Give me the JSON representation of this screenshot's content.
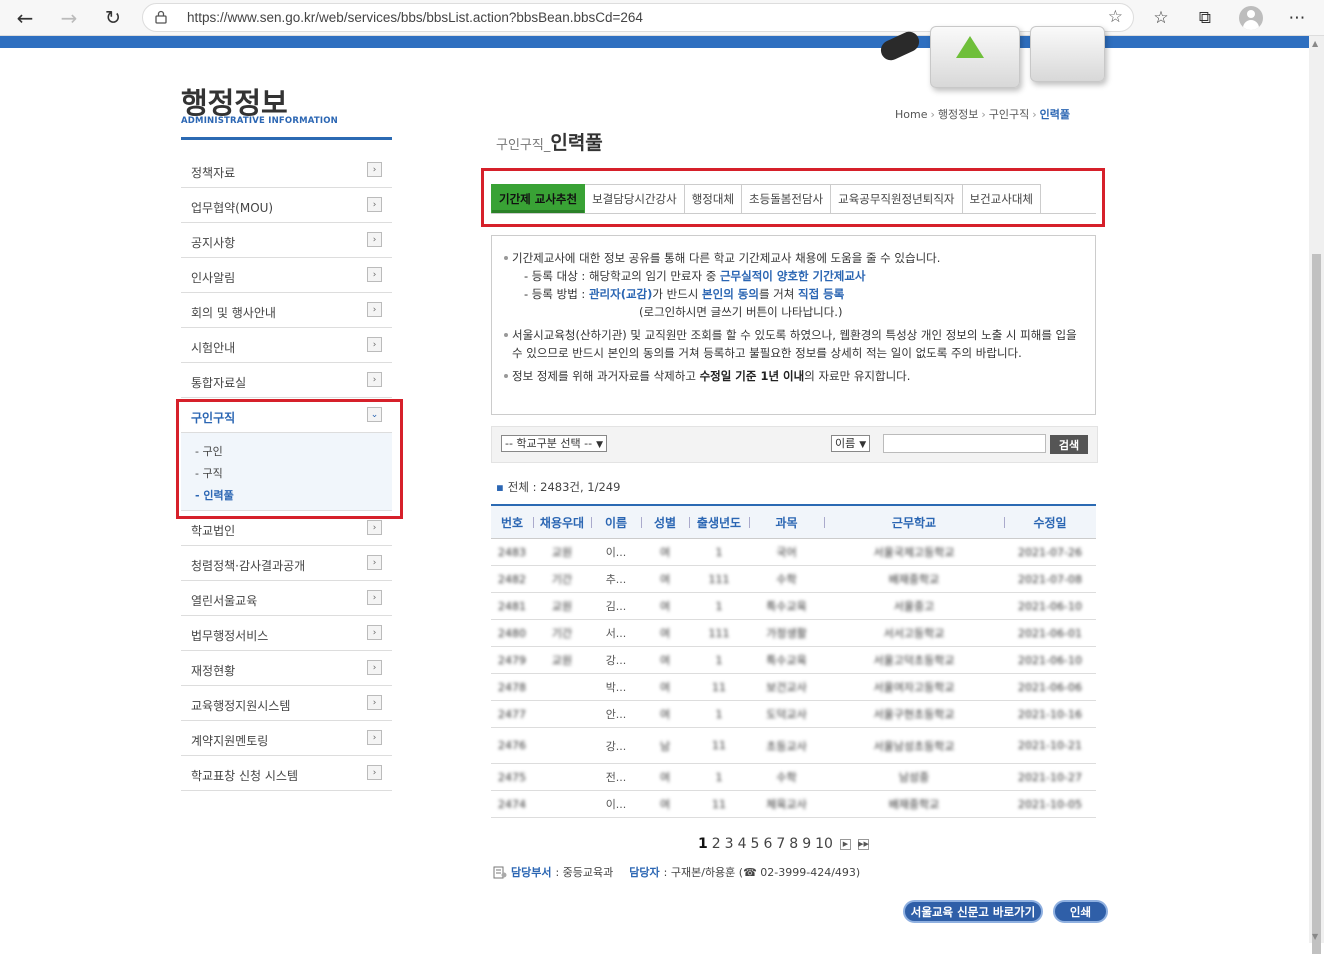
{
  "browser": {
    "url": "https://www.sen.go.kr/web/services/bbs/bbsList.action?bbsBean.bbsCd=264"
  },
  "left_menu": {
    "title": "행정정보",
    "subtitle": "ADMINISTRATIVE INFORMATION",
    "items": [
      {
        "label": "정책자료"
      },
      {
        "label": "업무협약(MOU)"
      },
      {
        "label": "공지사항"
      },
      {
        "label": "인사알림"
      },
      {
        "label": "회의 및 행사안내"
      },
      {
        "label": "시험안내"
      },
      {
        "label": "통합자료실"
      },
      {
        "label": "구인구직"
      },
      {
        "label": "학교법인"
      },
      {
        "label": "청렴정책·감사결과공개"
      },
      {
        "label": "열린서울교육"
      },
      {
        "label": "법무행정서비스"
      },
      {
        "label": "재정현황"
      },
      {
        "label": "교육행정지원시스템"
      },
      {
        "label": "계약지원멘토링"
      },
      {
        "label": "학교표창 신청 시스템"
      }
    ],
    "submenu": [
      "- 구인",
      "- 구직",
      "- 인력풀"
    ]
  },
  "breadcrumb": [
    "Home",
    "행정정보",
    "구인구직",
    "인력풀"
  ],
  "page_title": {
    "pre": "구인구직",
    "sep": "_",
    "main": "인력풀"
  },
  "tabs": [
    "기간제 교사추천",
    "보결담당시간강사",
    "행정대체",
    "초등돌봄전담사",
    "교육공무직원정년퇴직자",
    "보건교사대체"
  ],
  "notice": {
    "l1": "기간제교사에 대한 정보 공유를 통해 다른 학교 기간제교사 채용에 도움을 줄 수 있습니다.",
    "l2a": "- 등록 대상 : 해당학교의 임기 만료자 중 ",
    "l2b": "근무실적이 양호한 기간제교사",
    "l3a": "- 등록 방법 : ",
    "l3b": "관리자(교감)",
    "l3c": "가 반드시 ",
    "l3d": "본인의 동의",
    "l3e": "를 거쳐 ",
    "l3f": "직접 등록",
    "l4": "(로그인하시면 글쓰기 버튼이 나타납니다.)",
    "l5": "서울시교육청(산하기관) 및 교직원만 조회를 할 수 있도록 하였으나, 웹환경의 특성상 개인 정보의 노출 시 피해를 입을수 있으므로 반드시 본인의 동의를 거쳐 등록하고 불필요한 정보를 상세히 적는 일이 없도록 주의 바랍니다.",
    "l6a": "정보 정제를 위해 과거자료를 삭제하고 ",
    "l6b": "수정일 기준 1년 이내",
    "l6c": "의 자료만 유지합니다."
  },
  "search": {
    "school_select": "-- 학교구분 선택 --",
    "field_select": "이름",
    "button": "검색"
  },
  "total": "전체 : 2483건, 1/249",
  "table": {
    "headers": [
      "번호",
      "채용우대",
      "이름",
      "성별",
      "출생년도",
      "과목",
      "근무학교",
      "수정일"
    ],
    "rows": [
      [
        "2483",
        "교원",
        "이...",
        "여",
        "1",
        "국어",
        "서울국제고등학교",
        "2021-07-26"
      ],
      [
        "2482",
        "기간",
        "추...",
        "여",
        "111",
        "수학",
        "배재중학교",
        "2021-07-08"
      ],
      [
        "2481",
        "교원",
        "김...",
        "여",
        "1",
        "특수교육",
        "서울중고",
        "2021-06-10"
      ],
      [
        "2480",
        "기간",
        "서...",
        "여",
        "111",
        "가정생활",
        "서서고등학교",
        "2021-06-01"
      ],
      [
        "2479",
        "교원",
        "강...",
        "여",
        "1",
        "특수교육",
        "서울고덕초등학교",
        "2021-06-10"
      ],
      [
        "2478",
        "",
        "박...",
        "여",
        "11",
        "보건교사",
        "서울여자고등학교",
        "2021-06-06"
      ],
      [
        "2477",
        "",
        "안...",
        "여",
        "1",
        "도덕교사",
        "서울구현초등학교",
        "2021-10-16"
      ],
      [
        "2476",
        "",
        "강...",
        "남",
        "11",
        "초등교사",
        "서울남성초등학교",
        "2021-10-21"
      ],
      [
        "2475",
        "",
        "전...",
        "여",
        "1",
        "수학",
        "남성중",
        "2021-10-27"
      ],
      [
        "2474",
        "",
        "이...",
        "여",
        "11",
        "체육교사",
        "배재중학교",
        "2021-10-05"
      ]
    ]
  },
  "pager": {
    "pages": [
      "1",
      "2",
      "3",
      "4",
      "5",
      "6",
      "7",
      "8",
      "9",
      "10"
    ],
    "current": "1"
  },
  "contact": {
    "dept_label": "담당부서",
    "dept": ": 중등교육과",
    "person_label": "담당자",
    "person": ": 구재본/하용훈 (☎ 02-3999-424/493)"
  },
  "buttons": {
    "newspaper": "서울교육 신문고 바로가기",
    "print": "인쇄"
  },
  "colors": {
    "accent": "#2b66b3",
    "tab_active": "#39a235",
    "highlight_box": "#d6202a"
  }
}
